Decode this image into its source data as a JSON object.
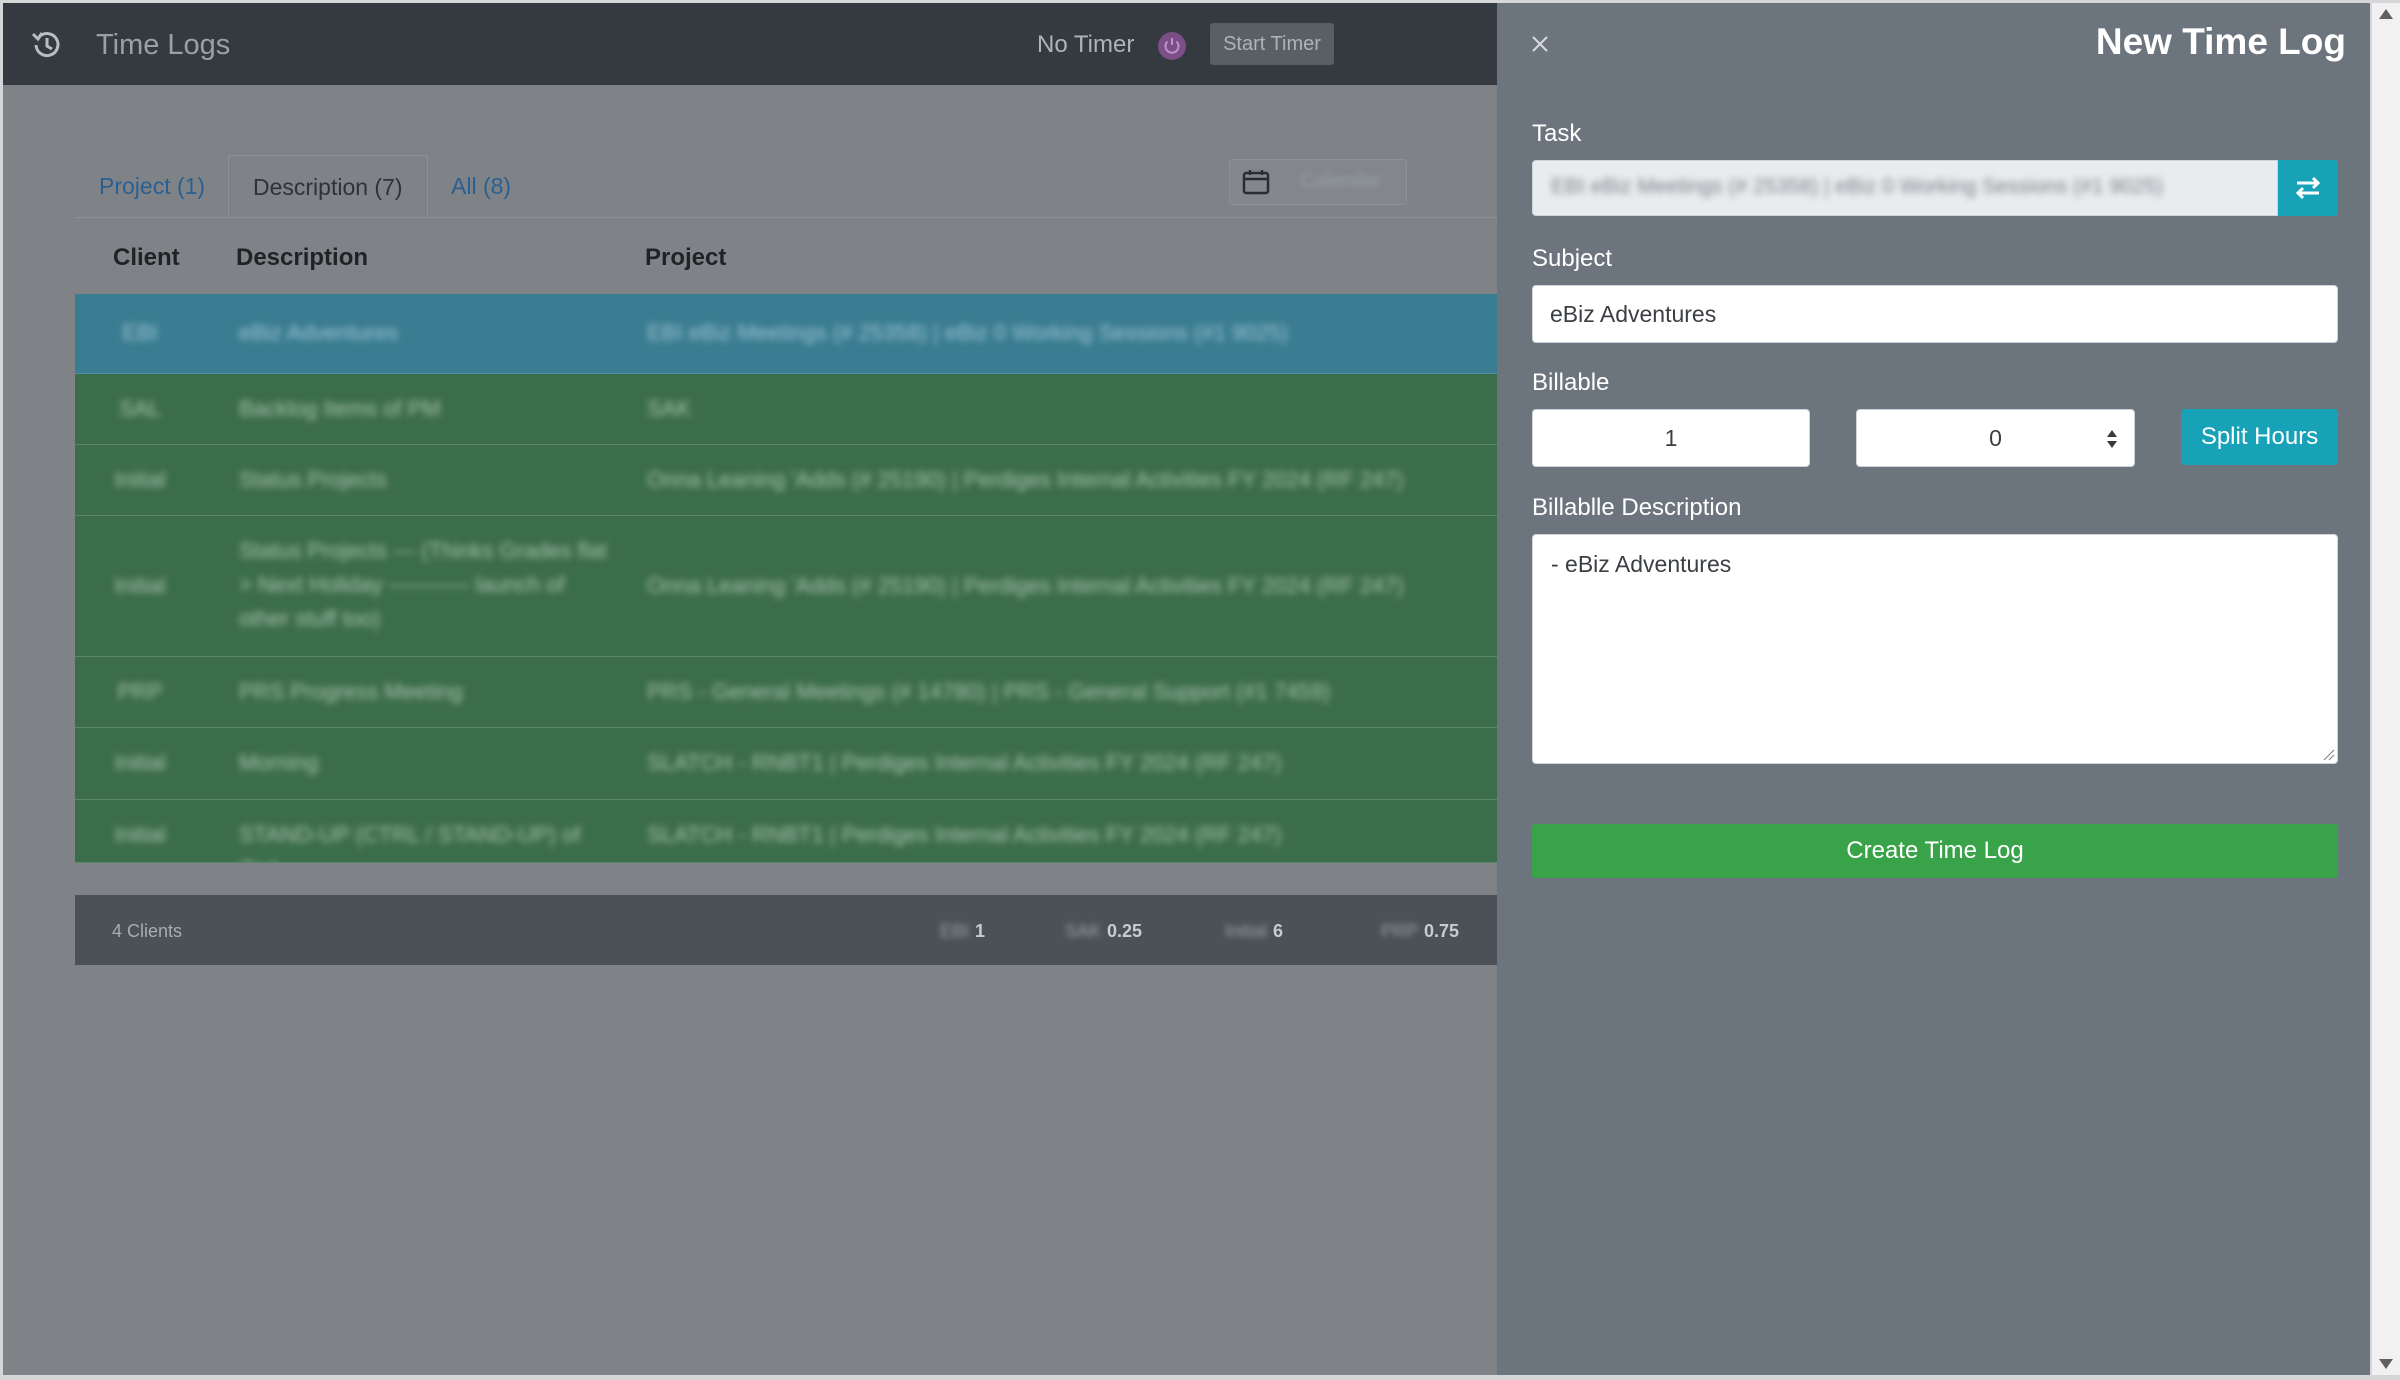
{
  "header": {
    "title": "Time Logs",
    "timer_status": "No Timer",
    "start_timer_label": "Start Timer"
  },
  "tabs": [
    {
      "label": "Project (1)",
      "active": false
    },
    {
      "label": "Description (7)",
      "active": true
    },
    {
      "label": "All (8)",
      "active": false
    }
  ],
  "date_filter": {
    "value": "Calendar"
  },
  "table": {
    "columns": [
      "Client",
      "Description",
      "Project"
    ],
    "rows": [
      {
        "client": "EBI",
        "description": "eBiz Adventures",
        "project": "EBI eBiz Meetings (# 25358) | eBiz 0 Working Sessions (#1 9025)",
        "selected": true
      },
      {
        "client": "SAL",
        "description": "Backlog Items of PM",
        "project": "SAK",
        "selected": false
      },
      {
        "client": "Initial",
        "description": "Status Projects",
        "project": "Onna Leaning 'Adds (# 25190) | Perdiges Internal Activities FY 2024 (RF 247)",
        "selected": false
      },
      {
        "client": "Initial",
        "description": "Status Projects --- (Thinks Grades flat > Next Holiday ----------- launch of other stuff too)",
        "project": "Onna Leaning 'Adds (# 25190) | Perdiges Internal Activities FY 2024 (RF 247)",
        "selected": false
      },
      {
        "client": "PRP",
        "description": "PRS Progress Meeting",
        "project": "PRS - General Meetings (# 14780) | PRS - General Support (#1 7459)",
        "selected": false
      },
      {
        "client": "Initial",
        "description": "Morning",
        "project": "SLATCH - RNBT1 | Perdiges Internal Activities FY 2024 (RF 247)",
        "selected": false
      },
      {
        "client": "Initial",
        "description": "STAND-UP (CTRL / STAND-UP) of Owl",
        "project": "SLATCH - RNBT1 | Perdiges Internal Activities FY 2024 (RF 247)",
        "selected": false
      }
    ],
    "footer": {
      "clients_label": "4 Clients",
      "stats": [
        {
          "key": "EBI",
          "value": "1"
        },
        {
          "key": "SAK",
          "value": "0.25"
        },
        {
          "key": "Initial",
          "value": "6"
        },
        {
          "key": "PRP",
          "value": "0.75"
        }
      ]
    }
  },
  "panel": {
    "title": "New Time Log",
    "task_label": "Task",
    "task_value": "EBI eBiz Meetings (# 25358) | eBiz 0 Working Sessions (#1 9025)",
    "subject_label": "Subject",
    "subject_value": "eBiz Adventures",
    "billable_label": "Billable",
    "hours_value": "1",
    "minutes_value": "0",
    "split_hours_label": "Split Hours",
    "billable_description_label": "Billablle Description",
    "billable_description_value": "- eBiz Adventures",
    "create_button_label": "Create Time Log"
  },
  "colors": {
    "topbar": "#343a40",
    "panel": "#6c757d",
    "accent": "#17a2b8",
    "success": "#38a349",
    "row_green": "#3c6d4a",
    "row_selected": "#3a7c91"
  }
}
